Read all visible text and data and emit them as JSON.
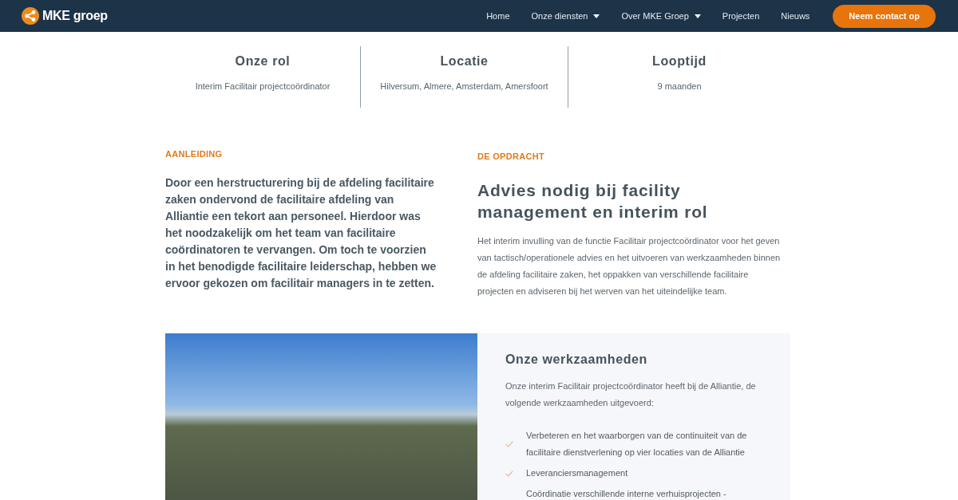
{
  "header": {
    "logo_text": "MKE groep",
    "nav": [
      {
        "label": "Home",
        "dropdown": false
      },
      {
        "label": "Onze diensten",
        "dropdown": true
      },
      {
        "label": "Over MKE Groep",
        "dropdown": true
      },
      {
        "label": "Projecten",
        "dropdown": false
      },
      {
        "label": "Nieuws",
        "dropdown": false
      }
    ],
    "cta": "Neem contact op"
  },
  "facts": [
    {
      "title": "Onze rol",
      "value": "Interim Facilitair projectcoördinator"
    },
    {
      "title": "Locatie",
      "value": "Hilversum, Almere, Amsterdam, Amersfoort"
    },
    {
      "title": "Looptijd",
      "value": "9 maanden"
    }
  ],
  "intro": {
    "label": "AANLEIDING",
    "text": "Door een herstructurering bij de afdeling facilitaire zaken ondervond de facilitaire afdeling van Alliantie een tekort aan personeel. Hierdoor was het noodzakelijk om het team van facilitaire coördinatoren te vervangen. Om toch te voorzien in het benodigde facilitaire leiderschap, hebben we ervoor gekozen om facilitair managers in te zetten."
  },
  "assignment": {
    "label": "DE OPDRACHT",
    "heading": "Advies nodig bij facility management en interim rol",
    "text": "Het interim invulling van de functie Facilitair projectcoördinator voor het geven van tactisch/operationele advies en het uitvoeren van werkzaamheden binnen de afdeling facilitaire zaken, het oppakken van verschillende facilitaire projecten en adviseren bij het werven van het uiteindelijke team."
  },
  "work": {
    "heading": "Onze werkzaamheden",
    "intro": "Onze interim Facilitair projectcoördinator heeft bij de Alliantie, de volgende werkzaamheden uitgevoerd:",
    "items": [
      {
        "text": "Verbeteren en het waarborgen van de continuiteit van de facilitaire dienstverlening op vier locaties van de Alliantie",
        "check": true
      },
      {
        "text": "Leveranciersmanagement",
        "check": true
      },
      {
        "text": "Coördinatie verschillende interne verhuisprojecten -",
        "check": false
      }
    ]
  }
}
